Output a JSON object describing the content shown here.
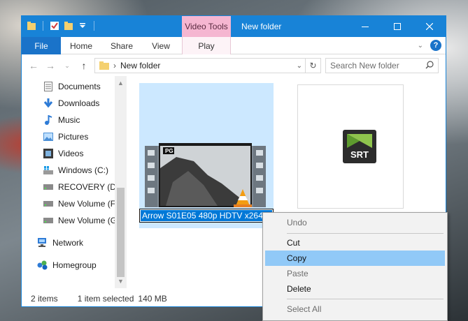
{
  "window": {
    "title": "New folder",
    "context_tab": "Video Tools",
    "minimize_icon": "minimize-icon",
    "maximize_icon": "maximize-icon",
    "close_icon": "close-icon"
  },
  "ribbon": {
    "tabs": [
      "File",
      "Home",
      "Share",
      "View",
      "Play"
    ],
    "expand_icon": "chevron-down-icon",
    "help_label": "?"
  },
  "address": {
    "path_label": "New folder",
    "search_placeholder": "Search New folder"
  },
  "nav": {
    "items": [
      {
        "label": "Documents",
        "icon": "documents-icon"
      },
      {
        "label": "Downloads",
        "icon": "downloads-icon"
      },
      {
        "label": "Music",
        "icon": "music-icon"
      },
      {
        "label": "Pictures",
        "icon": "pictures-icon"
      },
      {
        "label": "Videos",
        "icon": "videos-icon"
      },
      {
        "label": "Windows (C:)",
        "icon": "windows-drive-icon"
      },
      {
        "label": "RECOVERY (D:)",
        "icon": "drive-icon"
      },
      {
        "label": "New Volume (F",
        "icon": "drive-icon"
      },
      {
        "label": "New Volume (G",
        "icon": "drive-icon"
      },
      {
        "label": "Network",
        "icon": "network-icon"
      },
      {
        "label": "Homegroup",
        "icon": "homegroup-icon"
      }
    ]
  },
  "files": {
    "video_name_editing": "Arrow S01E05 480p HDTV x264",
    "srt_badge": "SRT",
    "pg_badge": "PG"
  },
  "status": {
    "items_count": "2 items",
    "selection": "1 item selected",
    "size": "140 MB"
  },
  "context_menu": {
    "items": [
      {
        "label": "Undo",
        "enabled": false
      },
      {
        "label": "Cut",
        "enabled": true
      },
      {
        "label": "Copy",
        "enabled": true,
        "highlighted": true
      },
      {
        "label": "Paste",
        "enabled": false
      },
      {
        "label": "Delete",
        "enabled": true
      },
      {
        "label": "Select All",
        "enabled": false
      }
    ]
  },
  "colors": {
    "titlebar": "#1883d7",
    "selection": "#cce8ff",
    "menu_highlight": "#91c9f7",
    "context_tab": "#f5b6d1"
  }
}
